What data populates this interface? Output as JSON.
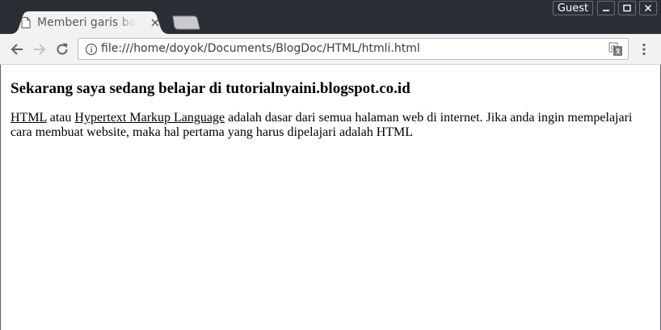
{
  "window": {
    "tab_title": "Memberi garis bawah",
    "guest_label": "Guest"
  },
  "icons": {
    "page": "document-icon",
    "close": "close-icon",
    "back": "back-arrow-icon",
    "forward": "forward-arrow-icon",
    "reload": "reload-icon",
    "info": "info-icon",
    "translate": "translate-icon",
    "menu": "kebab-menu-icon",
    "minimize": "minimize-icon",
    "maximize": "maximize-icon",
    "window_close": "window-close-icon"
  },
  "toolbar": {
    "url": "file:///home/doyok/Documents/BlogDoc/HTML/htmli.html"
  },
  "page": {
    "heading": "Sekarang saya sedang belajar di tutorialnyaini.blogspot.co.id",
    "link1": "HTML",
    "text1": " atau ",
    "link2": "Hypertext Markup Language",
    "text2": " adalah dasar dari semua halaman web di internet. Jika anda ingin mempelajari cara membuat website, maka hal pertama yang harus dipelajari adalah HTML"
  },
  "colors": {
    "titlebar": "#2b2e35",
    "toolbar": "#f2f2f2",
    "tab": "#f2f2f2",
    "content": "#ffffff"
  }
}
